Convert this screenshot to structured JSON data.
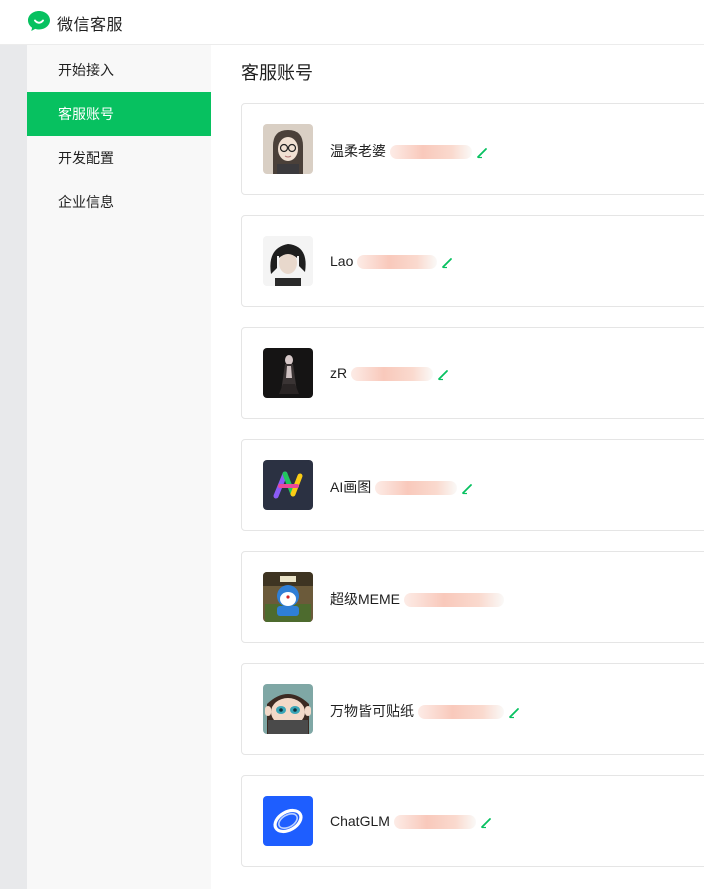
{
  "header": {
    "app_title": "微信客服",
    "brand_color": "#07c160"
  },
  "sidebar": {
    "items": [
      {
        "label": "开始接入",
        "active": false
      },
      {
        "label": "客服账号",
        "active": true
      },
      {
        "label": "开发配置",
        "active": false
      },
      {
        "label": "企业信息",
        "active": false
      }
    ]
  },
  "main": {
    "title": "客服账号",
    "accounts": [
      {
        "name": "温柔老婆",
        "avatar": "glasses-girl-avatar"
      },
      {
        "name": "Lao",
        "avatar": "dark-hair-portrait-avatar"
      },
      {
        "name": "zR",
        "avatar": "dark-figure-avatar"
      },
      {
        "name": "AI画图",
        "avatar": "ai-logo-avatar"
      },
      {
        "name": "超级MEME",
        "avatar": "cartoon-doraemon-avatar"
      },
      {
        "name": "万物皆可贴纸",
        "avatar": "sticker-girl-avatar"
      },
      {
        "name": "ChatGLM",
        "avatar": "chatglm-logo-avatar"
      }
    ],
    "edit_icon": "pencil-icon"
  }
}
